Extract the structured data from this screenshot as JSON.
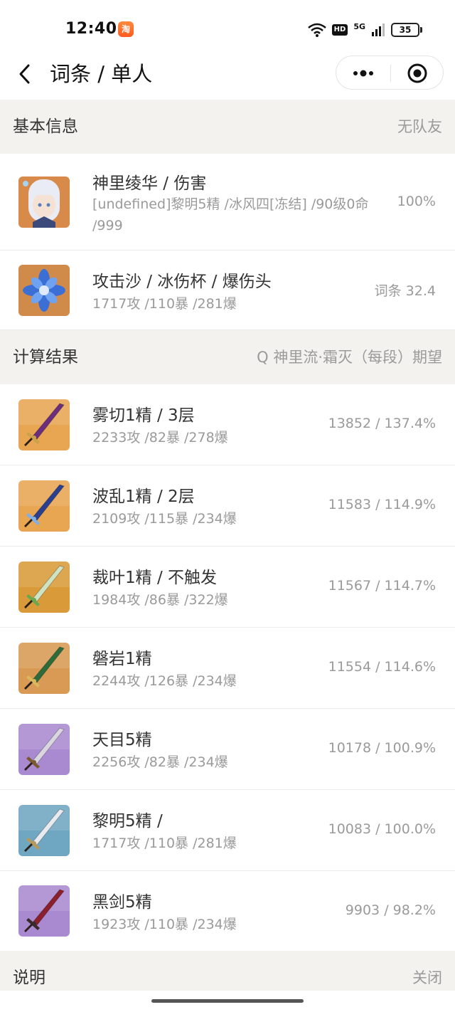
{
  "status_bar": {
    "time": "12:40",
    "battery": "35",
    "network": "5G",
    "hd": "HD"
  },
  "nav": {
    "title": "词条 / 单人"
  },
  "basic_info": {
    "title": "基本信息",
    "right": "无队友",
    "character": {
      "title": "神里绫华 / 伤害",
      "subtitle": "[undefined]黎明5精 /冰风四[冻结] /90级0命 /999",
      "value": "100%"
    },
    "artifact": {
      "title": "攻击沙 / 冰伤杯 / 爆伤头",
      "subtitle": "1717攻 /110暴 /281爆",
      "value": "词条 32.4"
    }
  },
  "results": {
    "title": "计算结果",
    "right": "Q 神里流·霜灭（每段）期望",
    "items": [
      {
        "title": "雾切1精 / 3层",
        "subtitle": "2233攻 /82暴 /278爆",
        "value": "13852 / 137.4%",
        "bg": "#e8a552",
        "blade": "#6b2d7d",
        "accent": "#c9a24a"
      },
      {
        "title": "波乱1精 / 2层",
        "subtitle": "2109攻 /115暴 /234爆",
        "value": "11583 / 114.9%",
        "bg": "#e8a552",
        "blade": "#2a3f8f",
        "accent": "#7fb0e8"
      },
      {
        "title": "裁叶1精 / 不触发",
        "subtitle": "1984攻 /86暴 /322爆",
        "value": "11567 / 114.7%",
        "bg": "#d99a3a",
        "blade": "#cfe3c2",
        "accent": "#6aa84f"
      },
      {
        "title": "磐岩1精",
        "subtitle": "2244攻 /126暴 /234爆",
        "value": "11554 / 114.6%",
        "bg": "#d99a55",
        "blade": "#2d6b3a",
        "accent": "#d8b85a"
      },
      {
        "title": "天目5精",
        "subtitle": "2256攻 /82暴 /234爆",
        "value": "10178 / 100.9%",
        "bg": "#a98ad0",
        "blade": "#d9d6e0",
        "accent": "#7a5a2e"
      },
      {
        "title": "黎明5精 /",
        "subtitle": "1717攻 /110暴 /281爆",
        "value": "10083 / 100.0%",
        "bg": "#6fa7c2",
        "blade": "#e9e9f0",
        "accent": "#b79a5a"
      },
      {
        "title": "黑剑5精",
        "subtitle": "1923攻 /110暴 /234爆",
        "value": "9903 / 98.2%",
        "bg": "#a98ad0",
        "blade": "#8b1f2a",
        "accent": "#3a2a2a"
      }
    ]
  },
  "notes": {
    "title": "说明",
    "right": "关闭"
  }
}
